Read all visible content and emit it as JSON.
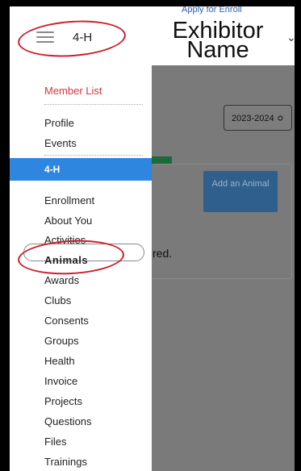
{
  "header": {
    "title": "4-H",
    "page_heading": "Exhibitor Name",
    "top_link_partial": "Apply for Enroll",
    "menu_icon": "hamburger-icon",
    "chevron_icon": "chevron-down-icon"
  },
  "background": {
    "year_select": "2023-2024 ≎",
    "add_animal_label": "Add an Animal",
    "partial_text": "red."
  },
  "drawer": {
    "member_list": "Member List",
    "profile": "Profile",
    "events": "Events",
    "section_label": "4-H",
    "items": [
      "Enrollment",
      "About You",
      "Activities",
      "Animals",
      "Awards",
      "Clubs",
      "Consents",
      "Groups",
      "Health",
      "Invoice",
      "Projects",
      "Questions",
      "Files",
      "Trainings"
    ]
  },
  "colors": {
    "accent_blue": "#2f86df",
    "member_list_red": "#d93541",
    "annotation_red": "#cc1f2b"
  }
}
